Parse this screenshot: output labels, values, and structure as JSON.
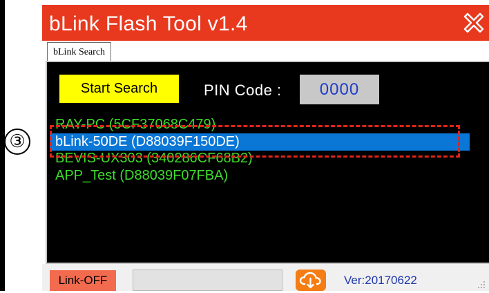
{
  "step_marker": "③",
  "window": {
    "title": "bLink Flash Tool v1.4",
    "close_icon": "close-x-icon",
    "accent": "#e8391f"
  },
  "tabs": [
    {
      "label": "bLink Search",
      "active": true
    }
  ],
  "search": {
    "button_label": "Start Search",
    "pin_label": "PIN Code :",
    "pin_value": "0000"
  },
  "devices": [
    {
      "label": "RAY-PC (5CF37068C479)",
      "selected": false
    },
    {
      "label": "bLink-50DE (D88039F150DE)",
      "selected": true
    },
    {
      "label": "BEVIS-UX303 (340286CF68B2)",
      "selected": false
    },
    {
      "label": "APP_Test (D88039F07FBA)",
      "selected": false
    }
  ],
  "status": {
    "link_state": "Link-OFF",
    "cloud_icon": "cloud-download-icon",
    "version": "Ver:20170622"
  },
  "colors": {
    "device_text": "#3edc2c",
    "selection": "#0a76d6",
    "highlight_box": "#e2241a",
    "search_button": "#ffff00",
    "pin_text": "#1e3cc8"
  }
}
